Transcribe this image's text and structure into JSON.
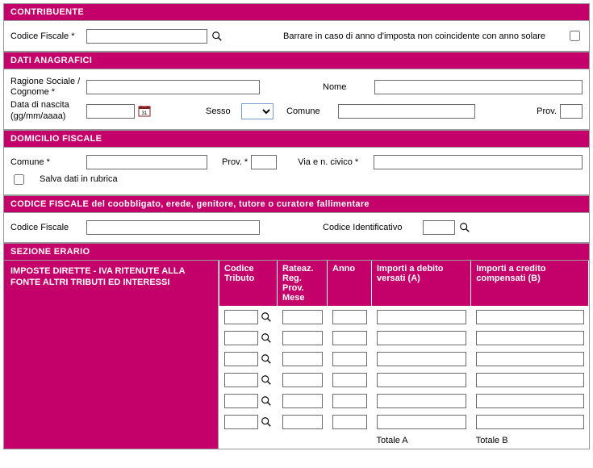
{
  "contribuente": {
    "header": "CONTRIBUENTE",
    "codice_fiscale_label": "Codice Fiscale *",
    "codice_fiscale": "",
    "barrare_label": "Barrare in caso di anno d'imposta non coincidente con anno solare"
  },
  "anagrafici": {
    "header": "DATI ANAGRAFICI",
    "ragione_label": "Ragione Sociale / Cognome *",
    "ragione": "",
    "nome_label": "Nome",
    "nome": "",
    "data_nascita_label": "Data di nascita (gg/mm/aaaa)",
    "data_nascita": "",
    "sesso_label": "Sesso",
    "comune_label": "Comune",
    "comune": "",
    "prov_label": "Prov.",
    "prov": ""
  },
  "domicilio": {
    "header": "DOMICILIO FISCALE",
    "comune_label": "Comune *",
    "comune": "",
    "prov_label": "Prov. *",
    "prov": "",
    "via_label": "Via e n. civico *",
    "via": "",
    "salva_label": "Salva dati in rubrica"
  },
  "coobbligato": {
    "header": "CODICE FISCALE del coobbligato, erede, genitore, tutore o curatore fallimentare",
    "codice_fiscale_label": "Codice Fiscale",
    "codice_fiscale": "",
    "codice_id_label": "Codice Identificativo",
    "codice_id": ""
  },
  "erario": {
    "header": "SEZIONE ERARIO",
    "subtitle": "IMPOSTE DIRETTE - IVA RITENUTE ALLA FONTE ALTRI TRIBUTI ED INTERESSI",
    "cols": {
      "codice": "Codice Tributo",
      "rateaz": "Rateaz. Reg. Prov. Mese",
      "anno": "Anno",
      "debito": "Importi a debito versati (A)",
      "credito": "Importi a credito compensati (B)"
    },
    "totale_a": "Totale A",
    "totale_b": "Totale B"
  }
}
